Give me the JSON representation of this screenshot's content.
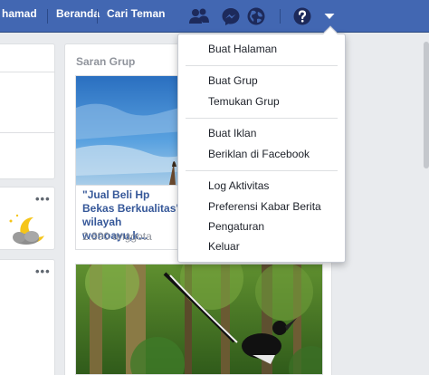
{
  "topbar": {
    "nav": [
      "hamad",
      "Beranda",
      "Cari Teman"
    ]
  },
  "sidebar": {
    "section_title": "Saran Grup",
    "group_card": {
      "title": "\"Jual Beli Hp Bekas Berkualitas\" wilayah wonoayu,k...",
      "members": "2.890 anggota"
    }
  },
  "dropdown": {
    "groups": [
      [
        "Buat Halaman"
      ],
      [
        "Buat Grup",
        "Temukan Grup"
      ],
      [
        "Buat Iklan",
        "Beriklan di Facebook"
      ],
      [
        "Log Aktivitas",
        "Preferensi Kabar Berita",
        "Pengaturan",
        "Keluar"
      ]
    ]
  },
  "colors": {
    "topbar": "#4267b2",
    "link": "#365899",
    "meta": "#90949c"
  },
  "icons": [
    "friend-requests-icon",
    "messenger-icon",
    "notifications-globe-icon",
    "help-icon",
    "account-menu-caret-icon",
    "more-options-icon"
  ]
}
